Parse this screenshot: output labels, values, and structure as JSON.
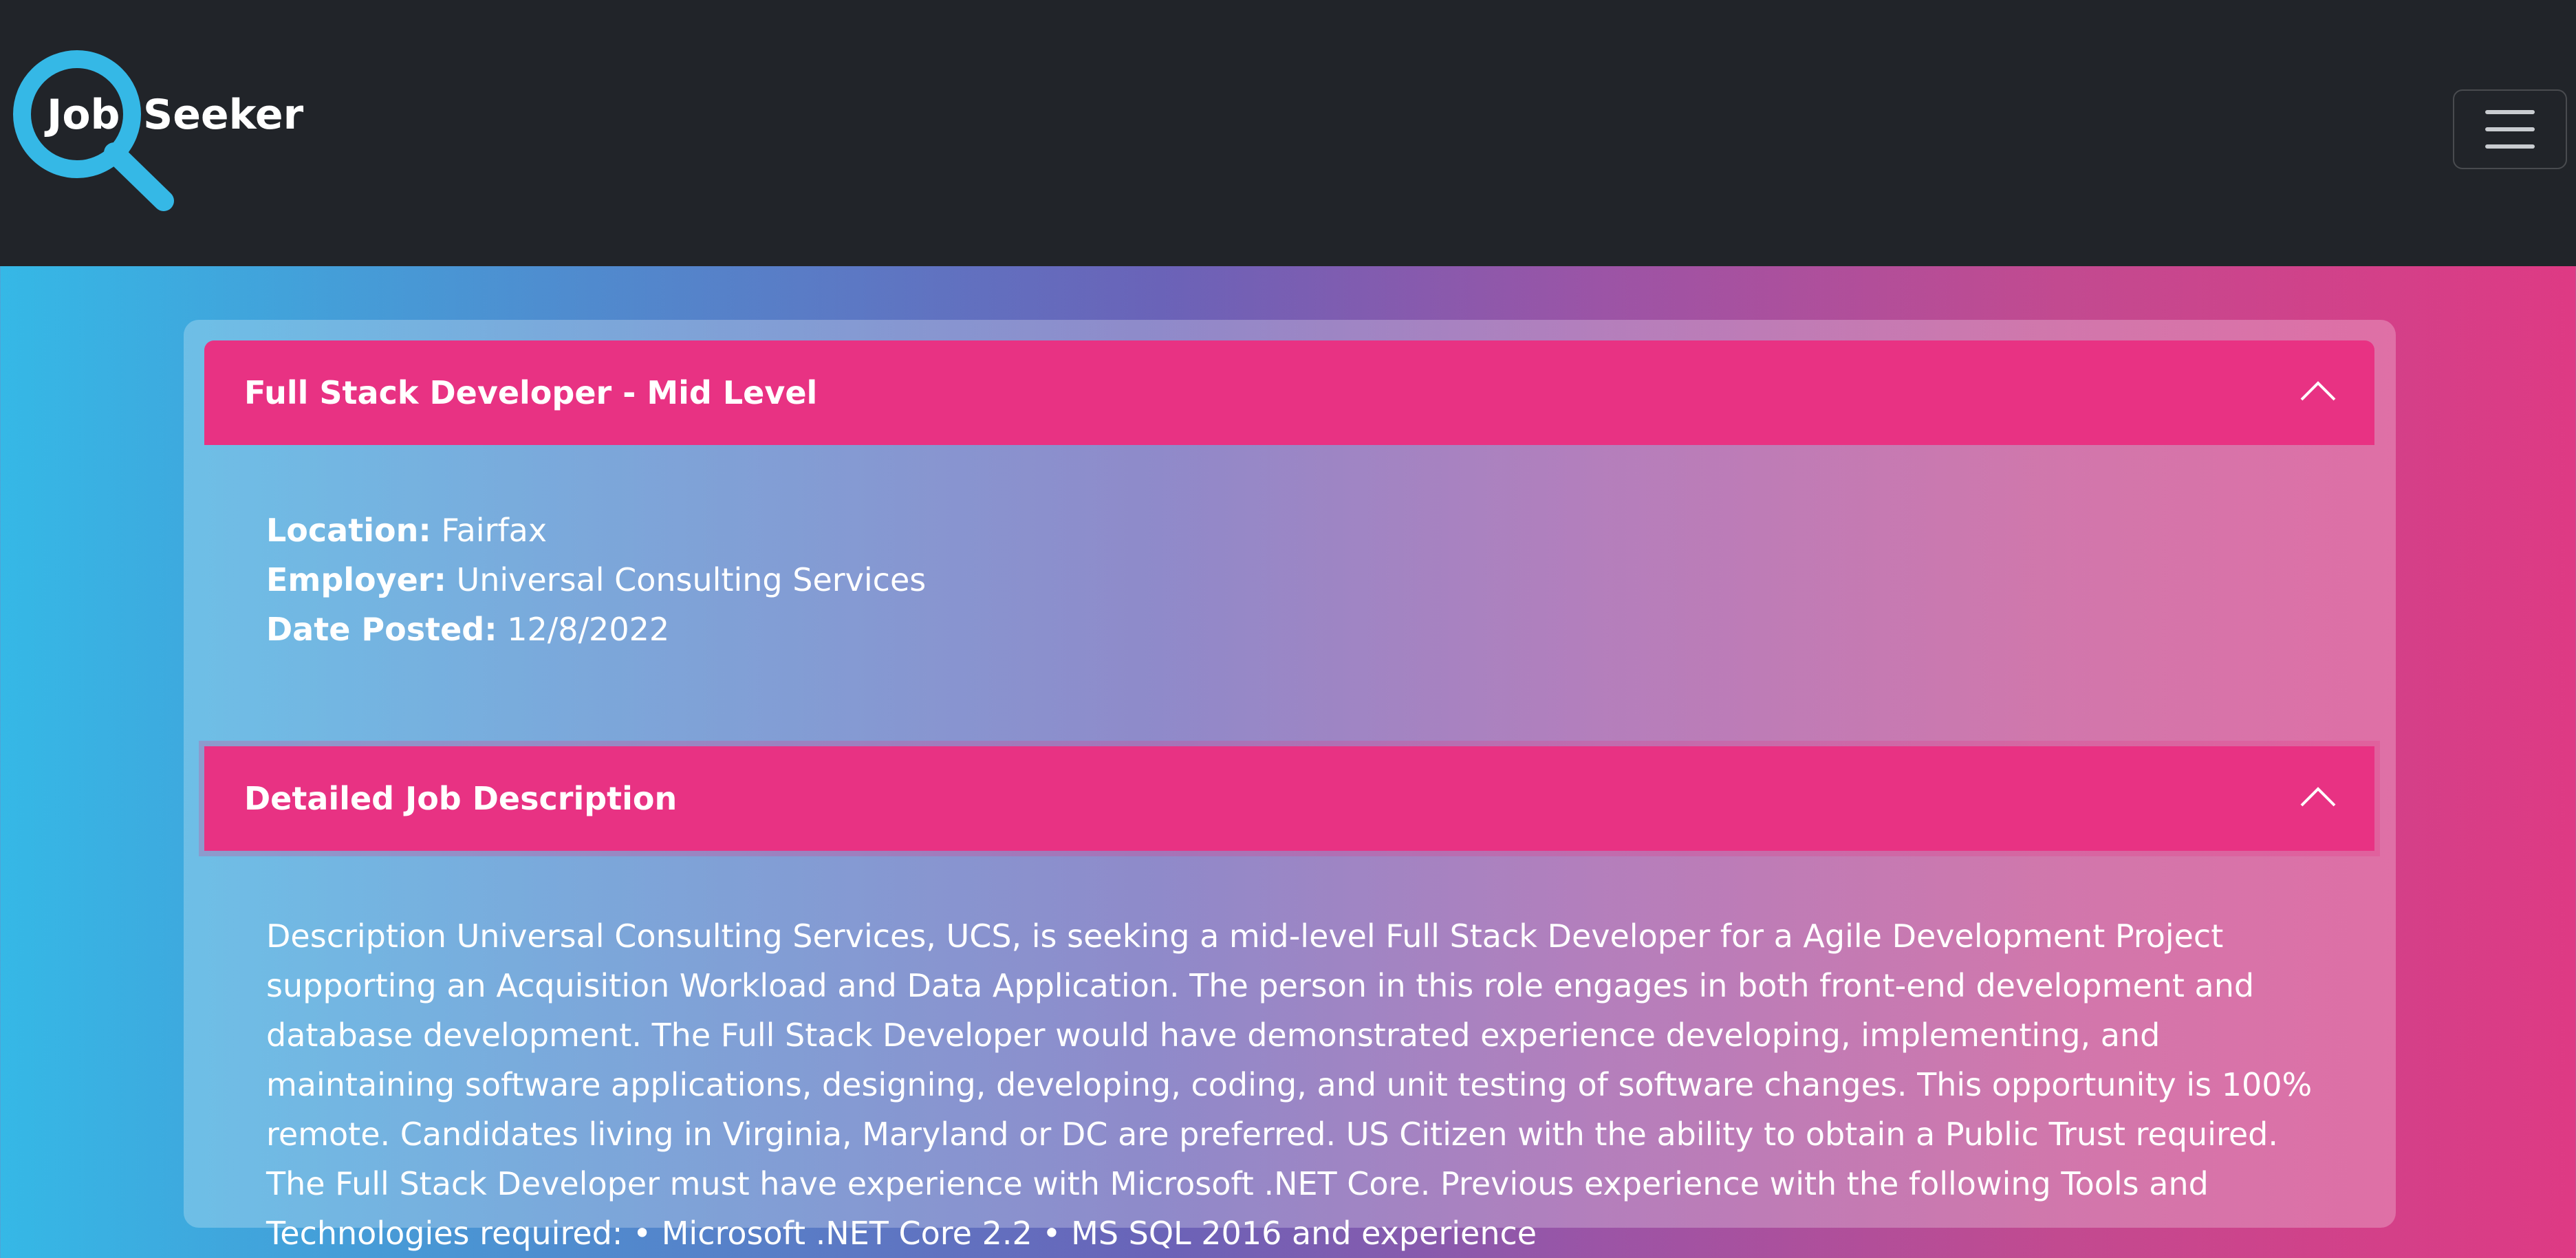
{
  "brand": {
    "job": "Job",
    "seeker": "Seeker"
  },
  "colors": {
    "nav_bg": "#212429",
    "accent": "#e83283",
    "logo_blue": "#35b8e6"
  },
  "icons": {
    "logo": "magnifier-icon",
    "menu": "hamburger-menu-icon",
    "collapse": "chevron-up-icon"
  },
  "job": {
    "title": "Full Stack Developer - Mid Level",
    "location_label": "Location:",
    "location": "Fairfax",
    "employer_label": "Employer:",
    "employer": "Universal Consulting Services",
    "date_label": "Date Posted:",
    "date": "12/8/2022"
  },
  "description": {
    "heading": "Detailed Job Description",
    "text": "Description Universal Consulting Services, UCS, is seeking a mid-level Full Stack Developer for a Agile Development Project supporting an Acquisition Workload and Data Application. The person in this role engages in both front-end development and database development. The Full Stack Developer would have demonstrated experience developing, implementing, and maintaining software applications, designing, developing, coding, and unit testing of software changes. This opportunity is 100% remote. Candidates living in Virginia, Maryland or DC are preferred. US Citizen with the ability to obtain a Public Trust required. The Full Stack Developer must have experience with Microsoft .NET Core. Previous experience with the following Tools and Technologies required: • Microsoft .NET Core 2.2 • MS SQL 2016 and experience"
  }
}
